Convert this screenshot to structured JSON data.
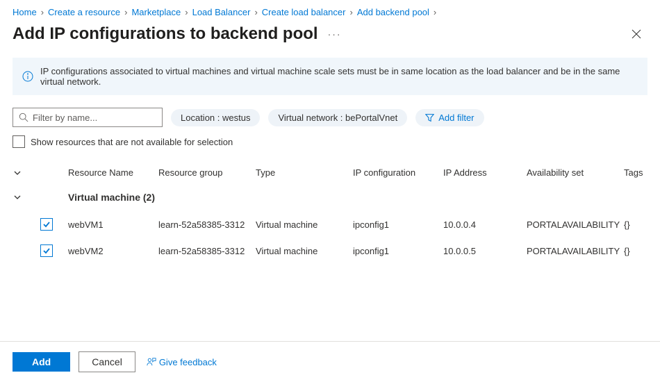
{
  "breadcrumb": [
    "Home",
    "Create a resource",
    "Marketplace",
    "Load Balancer",
    "Create load balancer",
    "Add backend pool"
  ],
  "title": "Add IP configurations to backend pool",
  "banner_text": "IP configurations associated to virtual machines and virtual machine scale sets must be in same location as the load balancer and be in the same virtual network.",
  "search": {
    "placeholder": "Filter by name..."
  },
  "filters": {
    "location_label": "Location : westus",
    "vnet_label": "Virtual network : bePortalVnet",
    "add_filter_label": "Add filter"
  },
  "show_checkbox_label": "Show resources that are not available for selection",
  "columns": {
    "name": "Resource Name",
    "rg": "Resource group",
    "type": "Type",
    "ipcfg": "IP configuration",
    "ipaddr": "IP Address",
    "avset": "Availability set",
    "tags": "Tags"
  },
  "group": {
    "label": "Virtual machine (2)"
  },
  "rows": [
    {
      "name": "webVM1",
      "rg": "learn-52a58385-3312",
      "type": "Virtual machine",
      "ipcfg": "ipconfig1",
      "ipaddr": "10.0.0.4",
      "avset": "PORTALAVAILABILITY",
      "tags": "{}"
    },
    {
      "name": "webVM2",
      "rg": "learn-52a58385-3312",
      "type": "Virtual machine",
      "ipcfg": "ipconfig1",
      "ipaddr": "10.0.0.5",
      "avset": "PORTALAVAILABILITY",
      "tags": "{}"
    }
  ],
  "footer": {
    "add": "Add",
    "cancel": "Cancel",
    "feedback": "Give feedback"
  }
}
